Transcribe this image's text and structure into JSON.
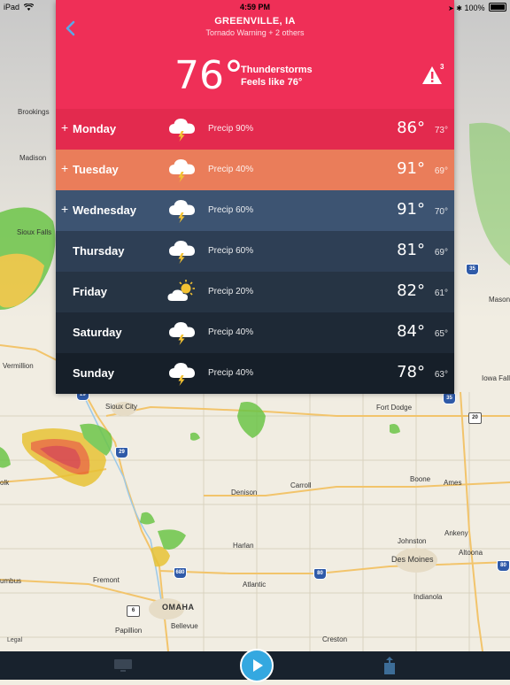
{
  "status_bar": {
    "device": "iPad",
    "time": "4:59 PM",
    "battery": "100%"
  },
  "header": {
    "location": "GREENVILLE, IA",
    "alerts": "Tornado Warning + 2 others",
    "current_temp": "76°",
    "condition": "Thunderstorms",
    "feels_like": "Feels like 76°",
    "warning_count": "3",
    "background_color": "#ef2f57"
  },
  "forecast": [
    {
      "day": "Monday",
      "expandable": true,
      "icon": "thunderstorm-icon",
      "precip": "Precip 90%",
      "high": "86°",
      "low": "73°",
      "color": "#e32a4e"
    },
    {
      "day": "Tuesday",
      "expandable": true,
      "icon": "thunderstorm-icon",
      "precip": "Precip 40%",
      "high": "91°",
      "low": "69°",
      "color": "#ea7d5a"
    },
    {
      "day": "Wednesday",
      "expandable": true,
      "icon": "thunderstorm-icon",
      "precip": "Precip 60%",
      "high": "91°",
      "low": "70°",
      "color": "#3d5472"
    },
    {
      "day": "Thursday",
      "expandable": false,
      "icon": "thunderstorm-icon",
      "precip": "Precip 60%",
      "high": "81°",
      "low": "69°",
      "color": "#2e3f55"
    },
    {
      "day": "Friday",
      "expandable": false,
      "icon": "partly-sunny-icon",
      "precip": "Precip 20%",
      "high": "82°",
      "low": "61°",
      "color": "#263444"
    },
    {
      "day": "Saturday",
      "expandable": false,
      "icon": "thunderstorm-icon",
      "precip": "Precip 40%",
      "high": "84°",
      "low": "65°",
      "color": "#1e2936"
    },
    {
      "day": "Sunday",
      "expandable": false,
      "icon": "thunderstorm-icon",
      "precip": "Precip 40%",
      "high": "78°",
      "low": "63°",
      "color": "#161f29"
    }
  ],
  "map": {
    "cities": [
      "Brookings",
      "Madison",
      "Sioux Falls",
      "Vermillion",
      "Sioux City",
      "Fort Dodge",
      "Denison",
      "Carroll",
      "Boone",
      "Ames",
      "Harlan",
      "Ankeny",
      "Johnston",
      "Des Moines",
      "Altoona",
      "Fremont",
      "Atlantic",
      "Indianola",
      "OMAHA",
      "Papillion",
      "Bellevue",
      "Creston",
      "olk",
      "umbus",
      "Iowa Falls",
      "Mason"
    ],
    "highways": [
      "35",
      "29",
      "35",
      "20",
      "29",
      "680",
      "80",
      "6",
      "80"
    ]
  },
  "toolbar": {
    "legal": "Legal",
    "tv_icon": "tv-icon",
    "play_icon": "play-icon",
    "share_icon": "share-icon"
  }
}
